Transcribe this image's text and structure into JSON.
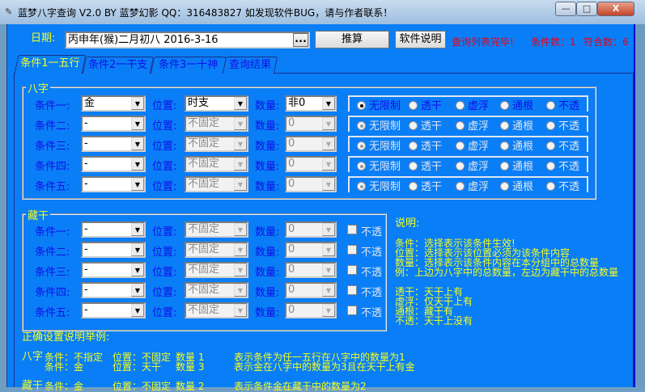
{
  "window": {
    "title": "蓝梦八字查询 V2.0 BY 蓝梦幻影 QQ：316483827 如发现软件BUG，请与作者联系！",
    "minimize": "—",
    "maximize": "□",
    "close": "X"
  },
  "toolbar": {
    "date_label": "日期:",
    "date_value": "丙申年(猴)二月初八  2016-3-16",
    "browse": "...",
    "calc": "推算",
    "help": "软件说明",
    "status": "查询列表完毕!",
    "cond_count": "条件数：1",
    "match_count": "符合数：6"
  },
  "tabs": [
    {
      "label": "条件1一五行"
    },
    {
      "label": "条件2一干支"
    },
    {
      "label": "条件3一十神"
    },
    {
      "label": "查询结果"
    }
  ],
  "bazi": {
    "title": "八字",
    "pos_label": "位置:",
    "qty_label": "数量:",
    "rows": [
      {
        "label": "条件一:",
        "cond": "金",
        "pos": "时支",
        "qty": "非0",
        "enabled": true
      },
      {
        "label": "条件二:",
        "cond": "-",
        "pos": "不固定",
        "qty": "0",
        "enabled": false
      },
      {
        "label": "条件三:",
        "cond": "-",
        "pos": "不固定",
        "qty": "0",
        "enabled": false
      },
      {
        "label": "条件四:",
        "cond": "-",
        "pos": "不固定",
        "qty": "0",
        "enabled": false
      },
      {
        "label": "条件五:",
        "cond": "-",
        "pos": "不固定",
        "qty": "0",
        "enabled": false
      }
    ],
    "radio_options": [
      "无限制",
      "透干",
      "虚浮",
      "通根",
      "不透"
    ],
    "radio_selected": "无限制"
  },
  "canggan": {
    "title": "藏干",
    "pos_label": "位置:",
    "qty_label": "数量:",
    "check_label": "不透",
    "rows": [
      {
        "label": "条件一:",
        "cond": "-",
        "pos": "不固定",
        "qty": "0"
      },
      {
        "label": "条件二:",
        "cond": "-",
        "pos": "不固定",
        "qty": "0"
      },
      {
        "label": "条件三:",
        "cond": "-",
        "pos": "不固定",
        "qty": "0"
      },
      {
        "label": "条件四:",
        "cond": "-",
        "pos": "不固定",
        "qty": "0"
      },
      {
        "label": "条件五:",
        "cond": "-",
        "pos": "不固定",
        "qty": "0"
      }
    ]
  },
  "notes": {
    "title": "说明:",
    "lines1": [
      "条件：选择表示该条件生效!",
      "位置：选择表示该位置必须为该条件内容",
      "数量：选择表示该条件内容在本分组中的总数量",
      "例：上边为八字中的总数量，左边为藏干中的总数量"
    ],
    "lines2": [
      "透干：天干上有",
      "虚浮：仅天干上有",
      "通根：藏干有",
      "不透：天干上没有"
    ]
  },
  "examples": {
    "title": "正确设置说明举例:",
    "rows": [
      {
        "group": "八字",
        "cond": "条件：不指定",
        "pos": "位置：不固定",
        "qty": "数量 1",
        "desc": "表示条件为任一五行在八字中的数量为1"
      },
      {
        "group": "",
        "cond": "条件：金",
        "pos": "位置：天干",
        "qty": "数量 3",
        "desc": "表示金在八字中的数量为3且在天干上有金"
      },
      {
        "group": "藏干",
        "cond": "条件：金",
        "pos": "位置：不固定",
        "qty": "数量 2",
        "desc": "表示条件金在藏干中的数量为2"
      }
    ]
  },
  "colors": {
    "background": "#0a7ef6",
    "label": "#1010e8",
    "notes": "#f4ff20",
    "status": "#e8001a"
  }
}
